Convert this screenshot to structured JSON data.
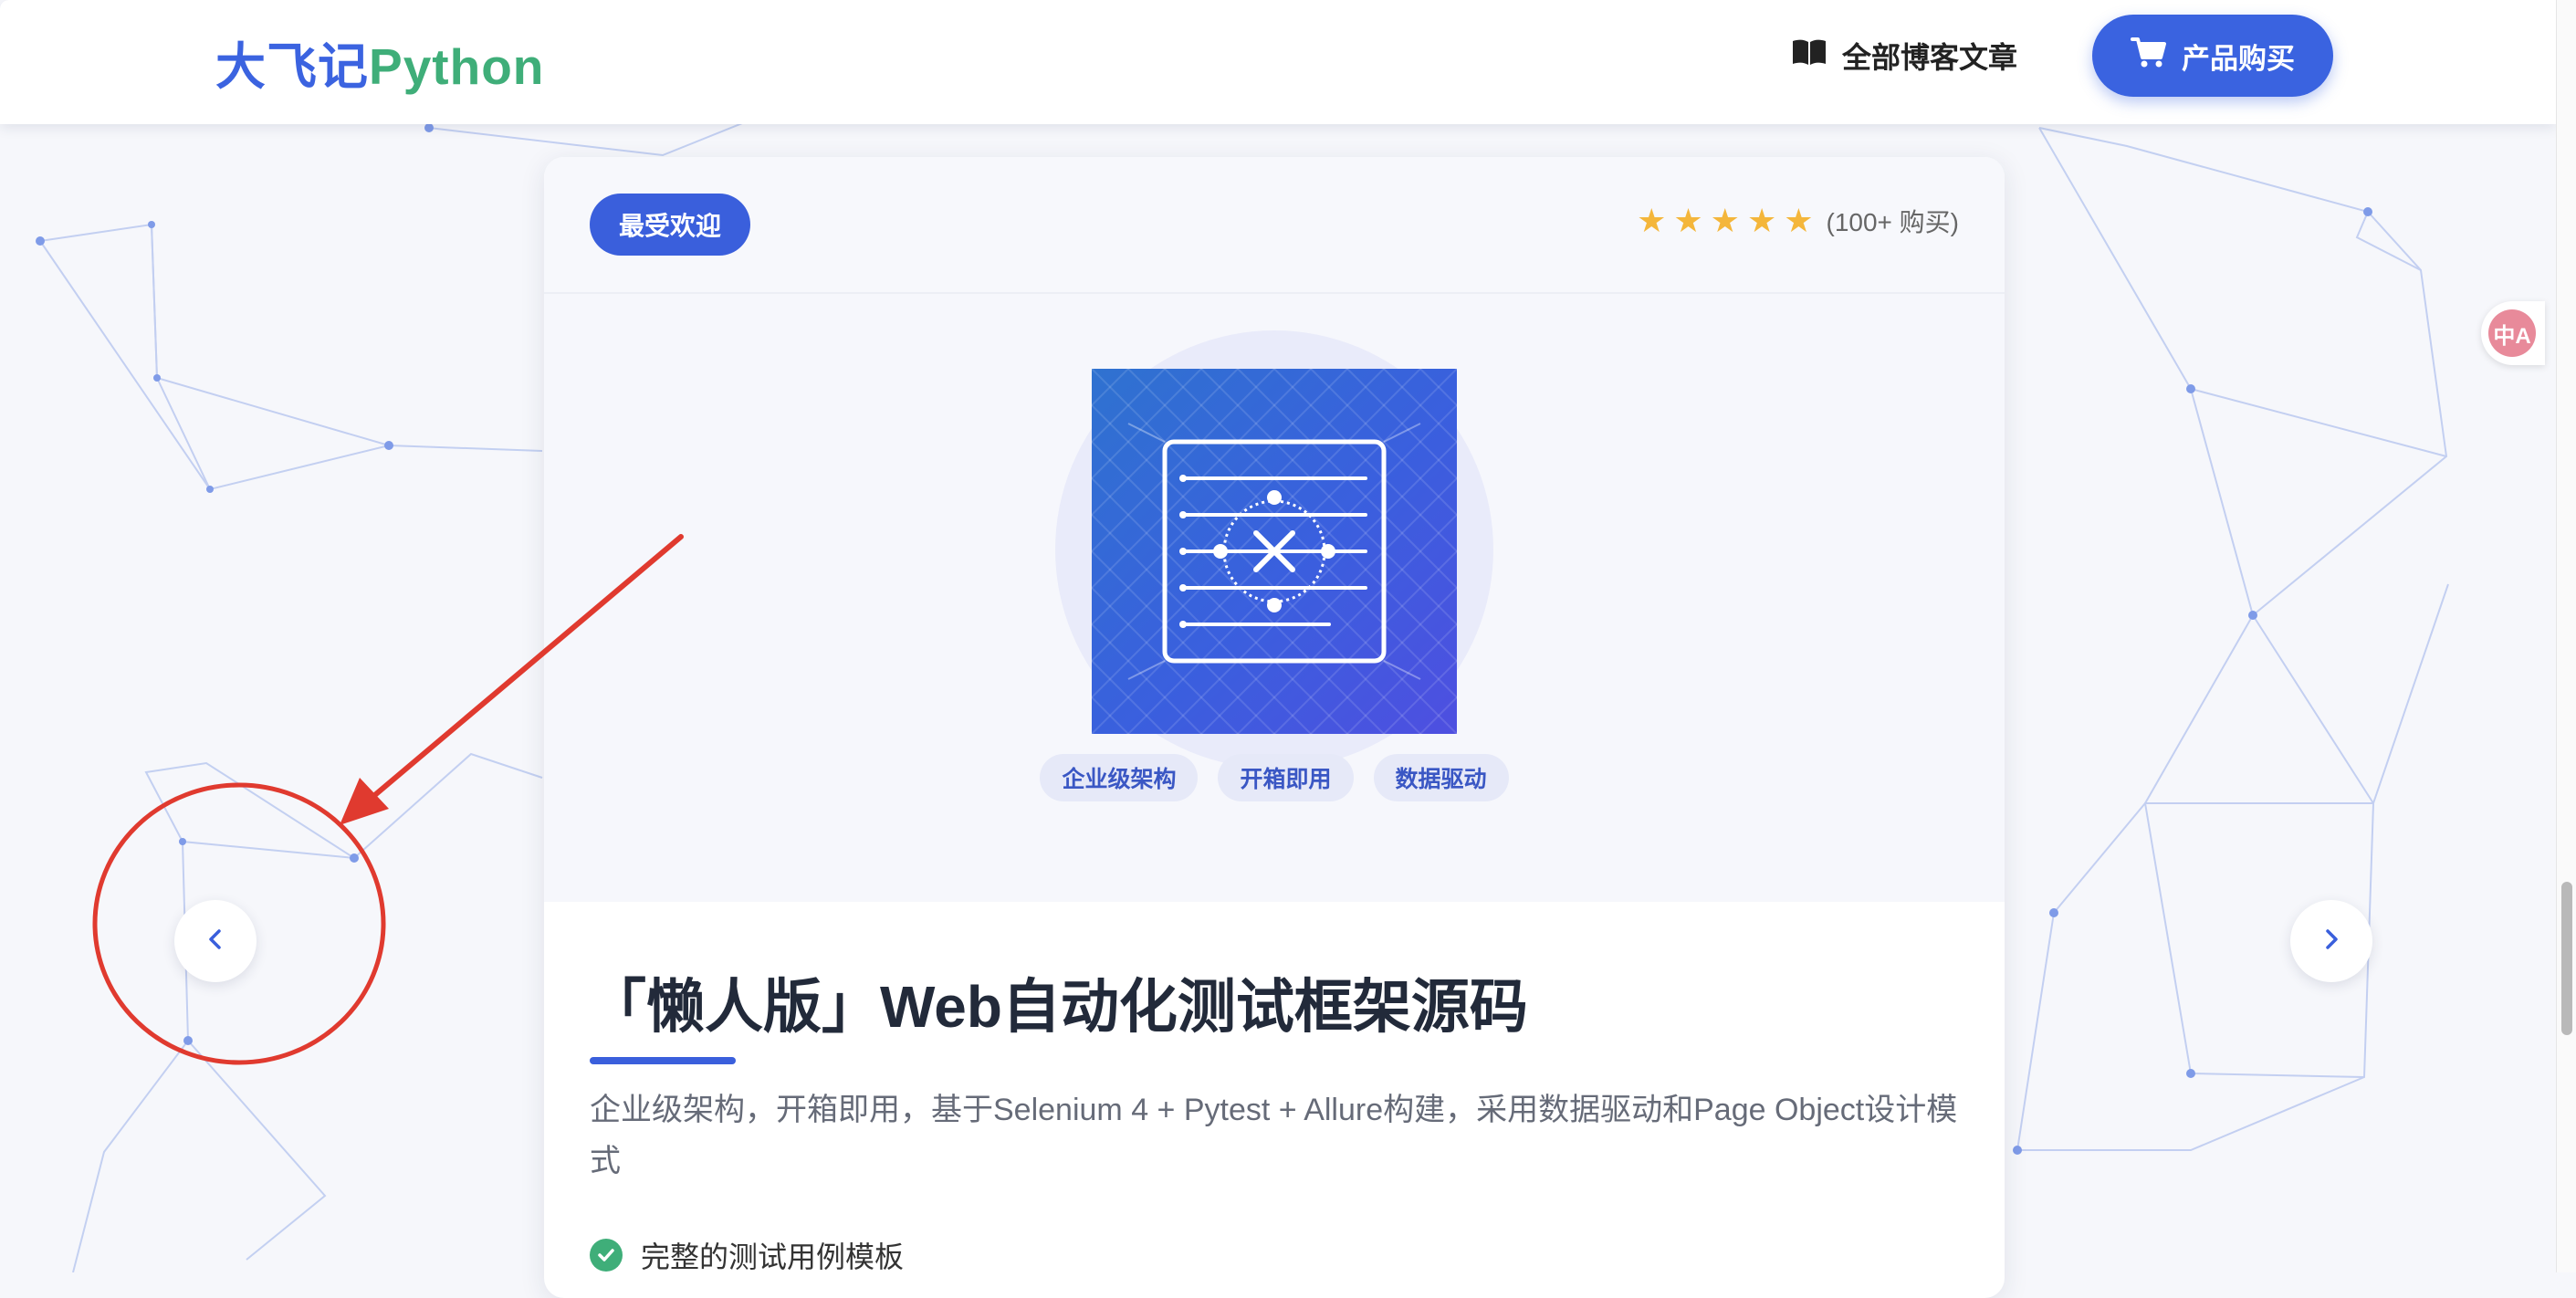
{
  "header": {
    "logo_cn": "大飞记",
    "logo_py": "Python",
    "nav_articles_label": "全部博客文章",
    "buy_button_label": "产品购买"
  },
  "translate_badge": {
    "label": "中A"
  },
  "card": {
    "badge_label": "最受欢迎",
    "rating": {
      "stars": 5,
      "text": "(100+ 购买)"
    },
    "tags": [
      "企业级架构",
      "开箱即用",
      "数据驱动"
    ],
    "title": "「懒人版」Web自动化测试框架源码",
    "description": "企业级架构，开箱即用，基于Selenium 4 + Pytest + Allure构建，采用数据驱动和Page Object设计模式",
    "features": [
      "完整的测试用例模板"
    ]
  },
  "colors": {
    "brand_blue": "#3a63e0",
    "brand_green": "#3fae79",
    "star_gold": "#f4b63b",
    "annotation_red": "#e03a2f"
  },
  "icons": {
    "nav_articles": "book-open-icon",
    "buy_button": "shopping-cart-icon",
    "prev": "chevron-left-icon",
    "next": "chevron-right-icon",
    "feature": "check-circle-icon"
  }
}
